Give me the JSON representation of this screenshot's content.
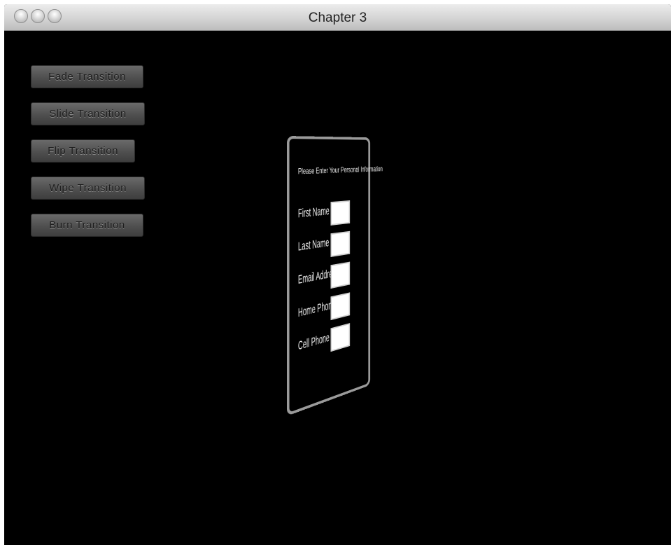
{
  "window": {
    "title": "Chapter 3"
  },
  "buttons": [
    {
      "label": "Fade Transition"
    },
    {
      "label": "Slide Transition"
    },
    {
      "label": "Flip Transition"
    },
    {
      "label": "Wipe Transition"
    },
    {
      "label": "Burn Transition"
    }
  ],
  "form": {
    "heading": "Please Enter Your Personal Information",
    "fields": [
      {
        "label": "First Name",
        "value": ""
      },
      {
        "label": "Last Name",
        "value": ""
      },
      {
        "label": "Email Address",
        "value": ""
      },
      {
        "label": "Home Phone",
        "value": ""
      },
      {
        "label": "Cell Phone",
        "value": ""
      }
    ]
  },
  "colors": {
    "background": "#000000",
    "panel_border": "#9a9a9a",
    "button": "#555555"
  }
}
